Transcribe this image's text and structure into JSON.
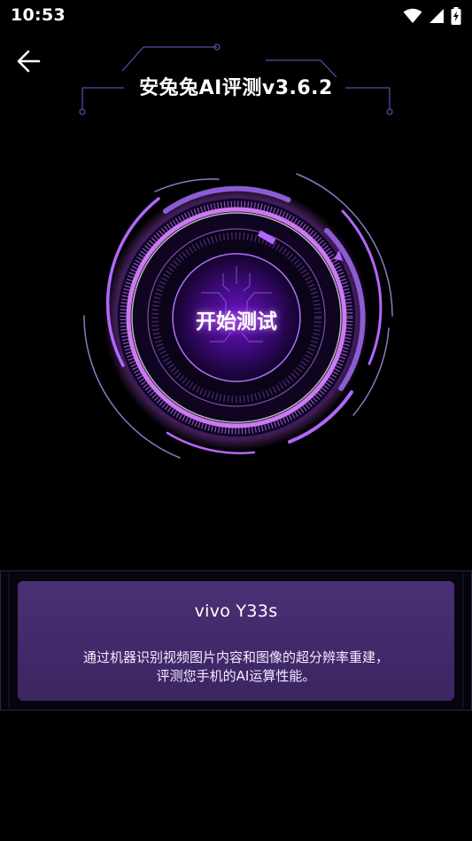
{
  "status_bar": {
    "time": "10:53",
    "icons": [
      "wifi-icon",
      "signal-icon",
      "battery-charging-icon"
    ]
  },
  "header": {
    "back_icon": "arrow-left-icon",
    "title": "安兔兔AI评测v3.6.2"
  },
  "dial": {
    "start_label": "开始测试"
  },
  "info": {
    "device": "vivo Y33s",
    "desc_line1": "通过机器识别视频图片内容和图像的超分辨率重建，",
    "desc_line2": "评测您手机的AI运算性能。"
  },
  "colors": {
    "background": "#000000",
    "accent": "#a64dff",
    "card": "#45296c"
  }
}
